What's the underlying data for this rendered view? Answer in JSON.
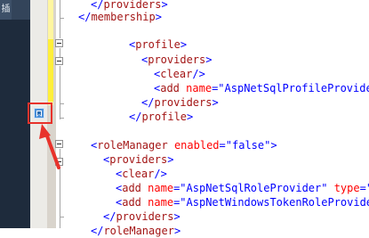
{
  "sidebar": {
    "tab_label": "插"
  },
  "code": {
    "l1_tag": "providers",
    "l2_tag": "membership",
    "l3_tag": "profile",
    "l4_tag": "providers",
    "l5_tag": "clear",
    "l6_tag": "add",
    "l6_attr": "name",
    "l6_val": "\"AspNetSqlProfileProvider",
    "l7_tag": "providers",
    "l8_tag": "profile",
    "l9_tag": "roleManager",
    "l9_attr": "enabled",
    "l9_val": "\"false\"",
    "l10_tag": "providers",
    "l11_tag": "clear",
    "l12_tag": "add",
    "l12_attr1": "name",
    "l12_val1": "\"AspNetSqlRoleProvider\"",
    "l12_attr2": "type",
    "l12_val2": "\"S",
    "l13_tag": "add",
    "l13_attr": "name",
    "l13_val": "\"AspNetWindowsTokenRoleProvider",
    "l14_tag": "providers",
    "l15_tag": "roleManager"
  },
  "colors": {
    "highlight": "#e8322b",
    "change_bar": "#ffef3a",
    "sidebar_bg": "#1e2b3c"
  }
}
